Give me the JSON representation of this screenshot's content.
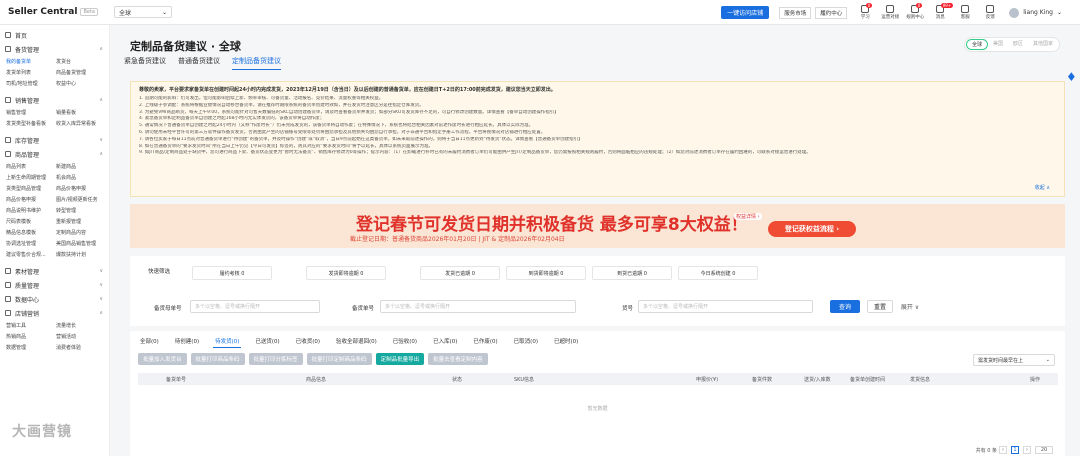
{
  "header": {
    "app_title": "Seller Central",
    "beta": "Beta",
    "region": "全球",
    "visit_store": "一键访问店铺",
    "links": [
      "服务市场",
      "履约中心"
    ],
    "icons": [
      {
        "name": "learn-icon",
        "label": "学习",
        "badge": "0"
      },
      {
        "name": "ops-icon",
        "label": "运营对接",
        "badge": ""
      },
      {
        "name": "rules-icon",
        "label": "规则中心",
        "badge": "0"
      },
      {
        "name": "message-icon",
        "label": "消息",
        "badge": "99+"
      },
      {
        "name": "service-icon",
        "label": "客服",
        "badge": ""
      },
      {
        "name": "feedback-icon",
        "label": "反馈",
        "badge": ""
      }
    ],
    "user": "liang King"
  },
  "sidebar": [
    {
      "label": "首页",
      "items": []
    },
    {
      "label": "备货管理",
      "items": [
        "我的备货单",
        "发货台",
        "发货单列表",
        "商品备货管理",
        "司机/地址管理",
        "权益中心"
      ],
      "active": 0
    },
    {
      "label": "销售管理",
      "items": [
        "销售管理",
        "销量看板",
        "发货类型补备看板",
        "收货入库异常看板"
      ]
    },
    {
      "label": "库存管理",
      "items": []
    },
    {
      "label": "商品管理",
      "items": [
        "商品列表",
        "新建商品",
        "上新生命周期管理",
        "机会商品",
        "货类型商品管理",
        "商品价格申报",
        "商品价格申报",
        "图片/视频更新任务",
        "商品说明书维护",
        "转型管理",
        "尺码表模板",
        "重新报管理",
        "精品信息模板",
        "定制商品内容",
        "协调选址管理",
        "美国商品销售管理",
        "建议零售价合规...",
        "爆款扶持计划"
      ]
    },
    {
      "label": "素材管理",
      "items": []
    },
    {
      "label": "质量管理",
      "items": []
    },
    {
      "label": "数据中心",
      "items": []
    },
    {
      "label": "店铺营销",
      "items": [
        "营销工具",
        "流量增长",
        "热销商品",
        "营销活动",
        "数据管理",
        "消费者体验"
      ]
    }
  ],
  "page": {
    "title": "定制品备货建议 · 全球",
    "tabs": [
      "紧急备货建议",
      "普通备货建议",
      "定制品备货建议"
    ],
    "active_tab": 2,
    "regions": [
      "全球",
      "美国",
      "欧区",
      "其他国家"
    ]
  },
  "notice": {
    "head": "尊敬的卖家，平台要求家备货单在创建时间起24小时内完成发货，2023年12月19日（含当日）及以后创建的普通备货单，应在创建日T+2日的17:00前完成发货，建议您当天立即发出。",
    "lines": [
      "1. 追期可能的影响：仍可发出，但可能影响后续上新、频率审核、可备货量、活动报名、竞价结果、流量权重等相关权益。",
      "2. 上线级子参调配：系统将根据业绩情况自动移合备货单，请在推荐时期限系统的备货单创建时效如，并在发货时注意区分是往指定仓库发货。",
      "3. 为避免VMI商品断货，每天上午9:00，系统可能针对可售天数偏低的SKC自动创建备货单，请及时查看备货单并发货；如部分SKU可发货库存不足的，可自行修改创建数量。详情查看【备单自动创建操作指引】",
      "4. 紧急备货单和定制品备货单自创建之时起168小时内无实体发货的，该备货单将自动作废；",
      "5. 通常情况下普通备货单自创建之时起24小时内（又称“作废时长”）仍未完成发货的，该备货单将自动作废；在特殊情况下，系统也将结合相关因素对前述作废时长进行相应延长，具体以实际为准。",
      "6. 请勿使用未经平台许可的第三方软件操作备货发货，否则由此产生的店铺账号受限等处罚将由您承担及其他损失均由您自行承担，对于非通平台和指定手册工作流程，平台将视情况对店铺进行相应处置。",
      "7. 请各位卖家于每日11点前对普通备货单进行“待创建”的备货单，并及时操作“创建”或“取消”，当日9点前起始在这类备货单，如未采取前述操作的，则将于当日11点更新到“待发货”状态。详情查看【普通备货单创建指引】",
      "8. 如在普通备货单的“要求发货时间”所在当日上午仍见【今日可发货】标签的，则其对应的“要求发货时间”将予以延长，具体以系统页面展示为准。",
      "9. 如JIT商品/定制商品处于缺货中，您可进行商品下架、备货状态变更为“暂时无法备货”、销售库存修改为0等操作；提示内容：（1）在卸载进行补时已有的未履约消费者订单仍可能由供产生JIT/定制品备货单，您仍需按照相关规则履约，否则将面临相应的违规处理；（2）如您对前述消费者订单存在履约困难的，可联系对接运营进行处理。"
    ],
    "more": "收起 ∧"
  },
  "banner": {
    "title": "登记春节可发货日期并积极备货 最多可享8大权益！",
    "subtitle": "截止登记日期：普通备货商品2026年01月20日 | JIT & 定制品2026年02月04日",
    "button": "登记获权益流程 ›",
    "tag": "权益详情 ›"
  },
  "filters": {
    "quick_label": "快速筛选",
    "chips": [
      "履约考核 0",
      "发货即将逾期 0",
      "发货已逾期 0",
      "到货即将逾期 0",
      "到货已逾期 0",
      "今日系统创建 0"
    ],
    "fields": [
      {
        "label": "备货母单号",
        "placeholder": "多个以空格、逗号或换行隔开"
      },
      {
        "label": "备货单号",
        "placeholder": "多个以空格、逗号或换行隔开"
      },
      {
        "label": "货号",
        "placeholder": "多个以空格、逗号或换行隔开"
      }
    ],
    "search": "查询",
    "reset": "重置",
    "expand": "展开 ∨"
  },
  "status_tabs": [
    "全部(0)",
    "待创建(0)",
    "待发货(0)",
    "已送货(0)",
    "已收货(0)",
    "验收全部退回(0)",
    "已验收(0)",
    "已入库(0)",
    "已作废(0)",
    "已取消(0)",
    "已超时(0)"
  ],
  "active_status": 2,
  "actions": [
    "批量加入发货台",
    "批量打印商品条码",
    "批量打印分拣标签",
    "批量打印定制商品条码",
    "定制品批量导出",
    "批量去查看定制内容"
  ],
  "sort": "需发货时间最早在上",
  "columns": [
    "备货单号",
    "商品信息",
    "状态",
    "SKU信息",
    "申报价(¥)",
    "备货件数",
    "送货/入库数",
    "备货单创建时间",
    "发货信息",
    "操作"
  ],
  "empty": "暂无数据",
  "pager": {
    "total": "共有 0 条",
    "page": "1",
    "size": "20"
  },
  "watermark": "大画营镜"
}
